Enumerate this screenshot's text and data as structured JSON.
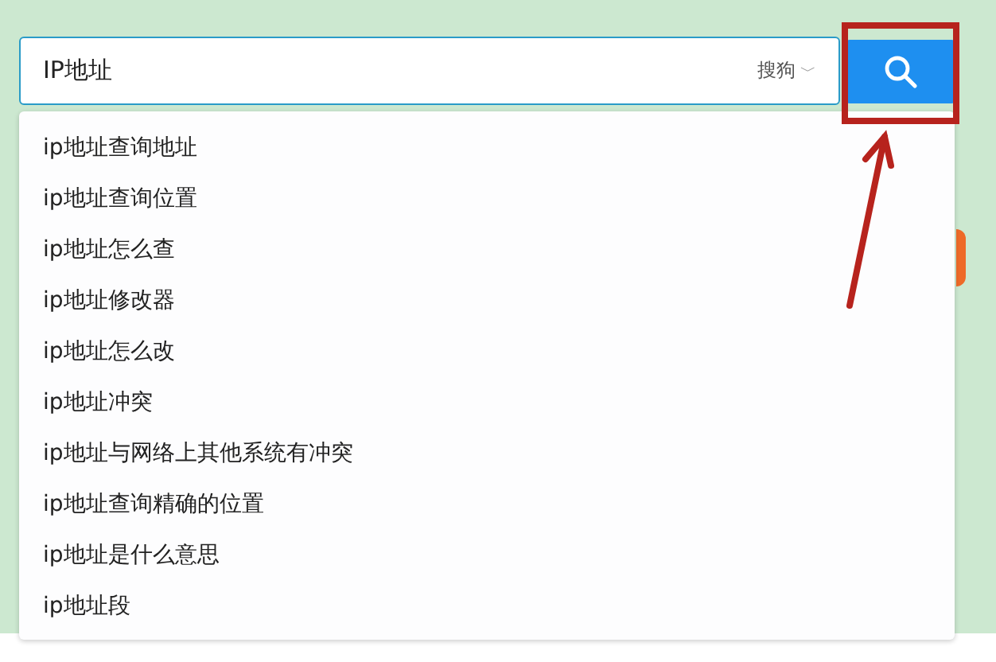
{
  "search": {
    "value": "IP地址",
    "engine": "搜狗",
    "engine_caret": "﹀"
  },
  "suggestions": [
    {
      "text": "ip地址查询地址"
    },
    {
      "text": "ip地址查询位置"
    },
    {
      "text": "ip地址怎么查"
    },
    {
      "text": "ip地址修改器"
    },
    {
      "text": "ip地址怎么改"
    },
    {
      "text": "ip地址冲突"
    },
    {
      "text": "ip地址与网络上其他系统有冲突"
    },
    {
      "text": "ip地址查询精确的位置"
    },
    {
      "text": "ip地址是什么意思"
    },
    {
      "text": "ip地址段"
    }
  ]
}
